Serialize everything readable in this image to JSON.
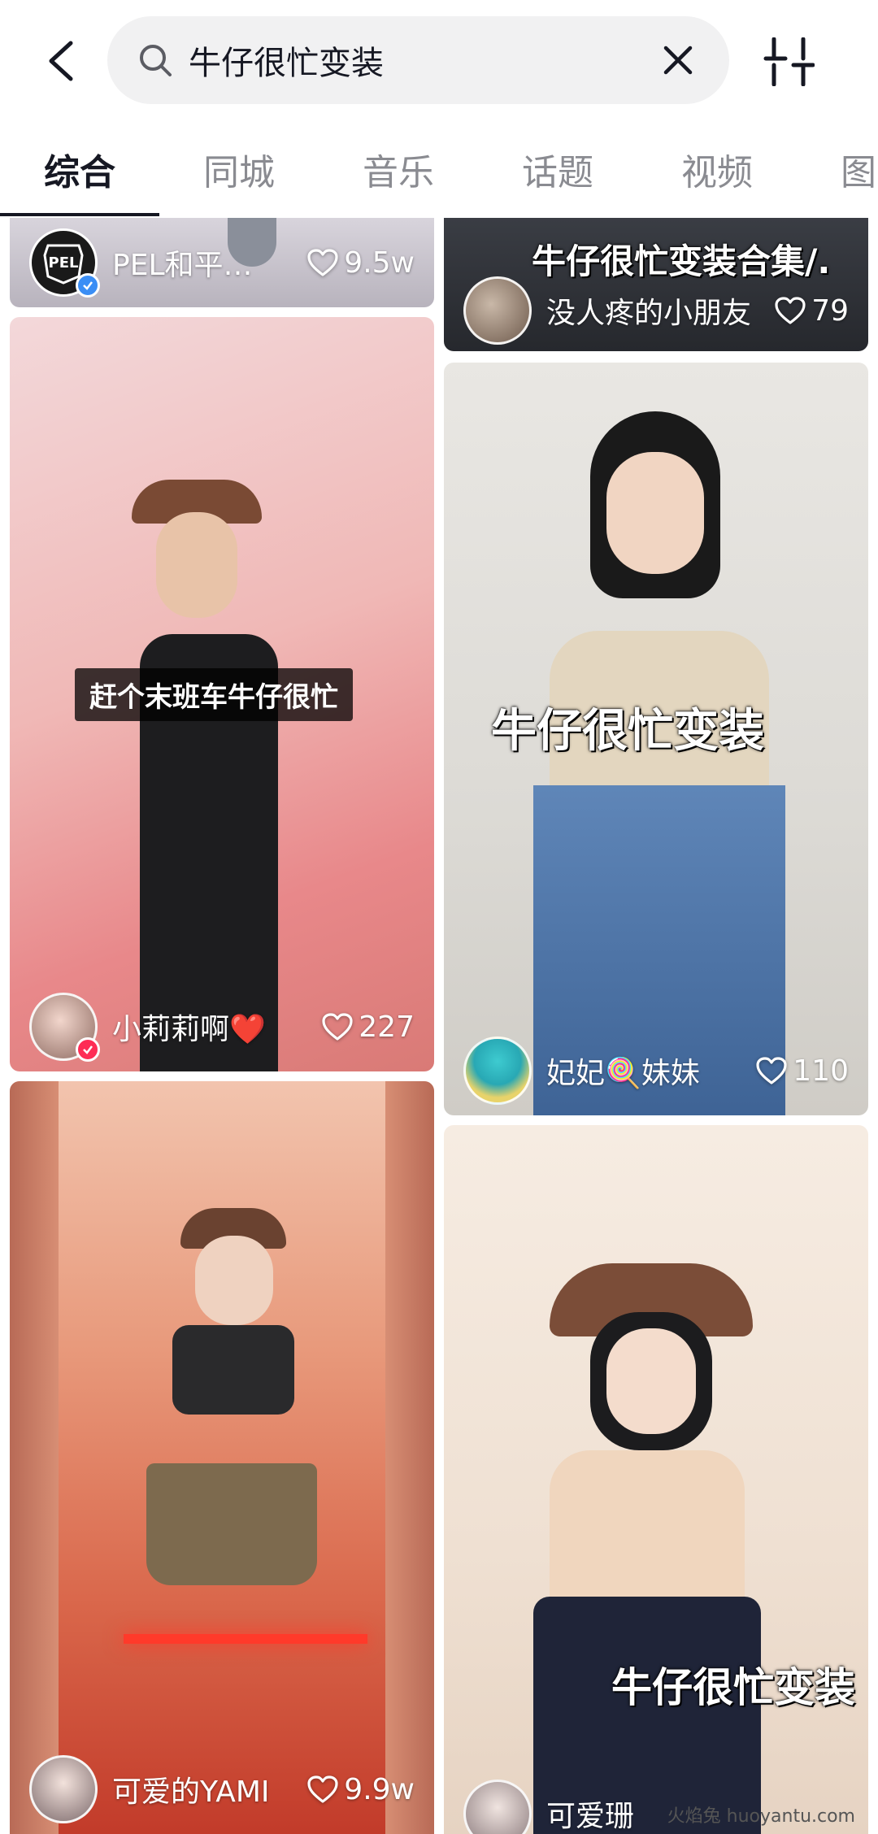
{
  "search": {
    "query": "牛仔很忙变装"
  },
  "tabs": [
    "综合",
    "同城",
    "音乐",
    "话题",
    "视频",
    "图"
  ],
  "cards": [
    {
      "author": "PEL和平…",
      "likes": "9.5w"
    },
    {
      "title": "牛仔很忙变装合集/.",
      "author": "没人疼的小朋友",
      "likes": "79"
    },
    {
      "overlay": "赶个末班车牛仔很忙",
      "author": "小莉莉啊❤️",
      "likes": "227"
    },
    {
      "overlay": "牛仔很忙变装",
      "author": "妃妃🍭妹妹",
      "likes": "110"
    },
    {
      "author": "可爱的YAMI",
      "likes": "9.9w"
    },
    {
      "overlay": "牛仔很忙变装",
      "author": "可爱珊"
    }
  ],
  "watermark": "火焰兔 huoyantu.com"
}
